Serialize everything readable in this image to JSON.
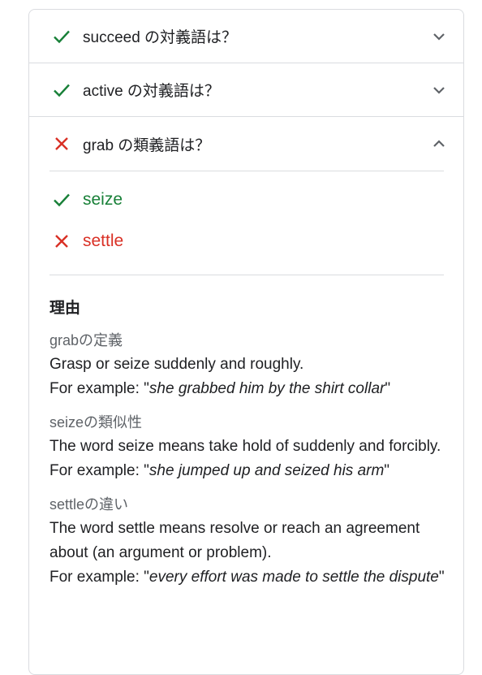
{
  "questions": [
    {
      "status": "correct",
      "text": "succeed の対義語は？",
      "expanded": false
    },
    {
      "status": "correct",
      "text": "active の対義語は？",
      "expanded": false
    },
    {
      "status": "wrong",
      "text": "grab の類義語は？",
      "expanded": true
    }
  ],
  "answers": {
    "correct_option": "seize",
    "selected_wrong_option": "settle"
  },
  "reason": {
    "title": "理由",
    "definition_label": "grabの定義",
    "definition_text": "Grasp or seize suddenly and roughly.",
    "definition_example_prefix": "For example: \"",
    "definition_example": "she grabbed him by the shirt collar",
    "definition_example_suffix": "\"",
    "similar_label": "seizeの類似性",
    "similar_text": "The word seize means take hold of suddenly and forcibly.",
    "similar_example_prefix": "For example: \"",
    "similar_example": "she jumped up and seized his arm",
    "similar_example_suffix": "\"",
    "diff_label": "settleの違い",
    "diff_text": "The word settle means resolve or reach an agreement about (an argument or problem).",
    "diff_example_prefix": "For example: \"",
    "diff_example": "every effort was made to settle the dispute",
    "diff_example_suffix": "\""
  },
  "colors": {
    "correct": "#188038",
    "wrong": "#d93025",
    "border": "#dadce0"
  },
  "icons": [
    "check-icon",
    "cross-icon",
    "chevron-down-icon",
    "chevron-up-icon"
  ]
}
